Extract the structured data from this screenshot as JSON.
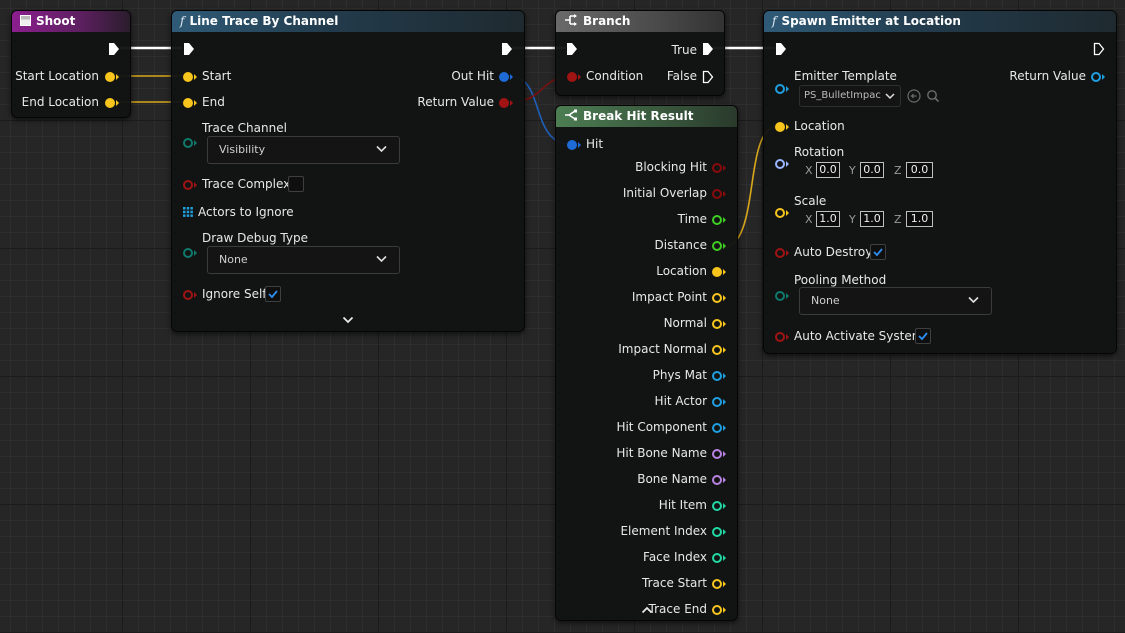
{
  "colors": {
    "exec": "#ffffff",
    "vector": "#f7c51c",
    "boolean": "#8a0b0b",
    "struct": "#1e6bd6",
    "name": "#b883e0",
    "int": "#21d9a4",
    "float": "#3fcd24",
    "object": "#1f9fe0",
    "enum": "#0f7a6b"
  },
  "shoot": {
    "title": "Shoot",
    "start_location": "Start Location",
    "end_location": "End Location"
  },
  "line_trace": {
    "title": "Line Trace By Channel",
    "start": "Start",
    "end": "End",
    "out_hit": "Out Hit",
    "return_value": "Return Value",
    "trace_channel": "Trace Channel",
    "trace_channel_value": "Visibility",
    "trace_complex": "Trace Complex",
    "actors_to_ignore": "Actors to Ignore",
    "draw_debug_type": "Draw Debug Type",
    "draw_debug_value": "None",
    "ignore_self": "Ignore Self"
  },
  "branch": {
    "title": "Branch",
    "condition": "Condition",
    "true_label": "True",
    "false_label": "False"
  },
  "break_hit": {
    "title": "Break Hit Result",
    "hit": "Hit",
    "outputs": [
      "Blocking Hit",
      "Initial Overlap",
      "Time",
      "Distance",
      "Location",
      "Impact Point",
      "Normal",
      "Impact Normal",
      "Phys Mat",
      "Hit Actor",
      "Hit Component",
      "Hit Bone Name",
      "Bone Name",
      "Hit Item",
      "Element Index",
      "Face Index",
      "Trace Start",
      "Trace End"
    ]
  },
  "spawn": {
    "title": "Spawn Emitter at Location",
    "emitter_template": "Emitter Template",
    "emitter_value": "PS_BulletImpac",
    "return_value": "Return Value",
    "location": "Location",
    "rotation": "Rotation",
    "rot_x": "0.0",
    "rot_y": "0.0",
    "rot_z": "0.0",
    "scale": "Scale",
    "scale_x": "1.0",
    "scale_y": "1.0",
    "scale_z": "1.0",
    "axis_x": "X",
    "axis_y": "Y",
    "axis_z": "Z",
    "auto_destroy": "Auto Destroy",
    "pooling_method": "Pooling Method",
    "pooling_value": "None",
    "auto_activate": "Auto Activate System"
  }
}
